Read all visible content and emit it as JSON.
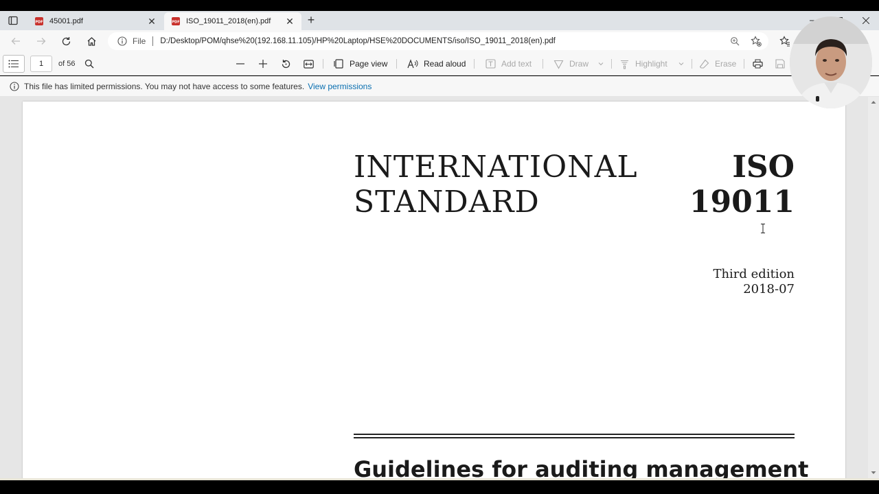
{
  "tabs": [
    {
      "title": "45001.pdf",
      "active": false
    },
    {
      "title": "ISO_19011_2018(en).pdf",
      "active": true
    }
  ],
  "address": {
    "scheme_label": "File",
    "url": "D:/Desktop/POM/qhse%20(192.168.11.105)/HP%20Laptop/HSE%20DOCUMENTS/iso/ISO_19011_2018(en).pdf"
  },
  "pdf_toolbar": {
    "page_number": "1",
    "page_total": "of 56",
    "page_view_label": "Page view",
    "read_aloud_label": "Read aloud",
    "add_text_label": "Add text",
    "draw_label": "Draw",
    "highlight_label": "Highlight",
    "erase_label": "Erase"
  },
  "permissions": {
    "message": "This file has limited permissions. You may not have access to some features.",
    "link": "View permissions"
  },
  "document": {
    "title_left": "INTERNATIONAL\nSTANDARD",
    "title_right": "ISO\n19011",
    "edition": "Third edition",
    "date": "2018-07",
    "subtitle": "Guidelines for auditing management"
  },
  "colors": {
    "link": "#0a6fb0",
    "pdf_red": "#c8302b",
    "tabstrip_bg": "#dfe3e7",
    "toolbar_bg": "#f7f7f7"
  }
}
